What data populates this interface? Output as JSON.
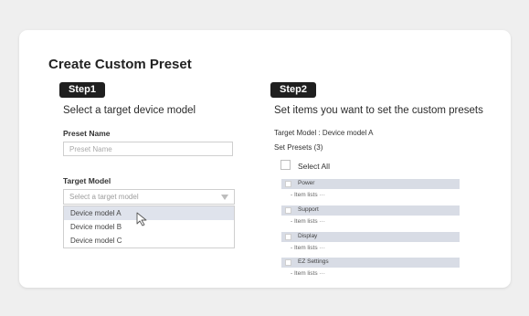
{
  "title": "Create Custom Preset",
  "step1": {
    "badge": "Step1",
    "heading": "Select a target device model",
    "preset_name_label": "Preset Name",
    "preset_name_placeholder": "Preset Name",
    "preset_name_value": "",
    "target_model_label": "Target Model",
    "target_model_placeholder": "Select a target model",
    "options": [
      "Device model A",
      "Device model B",
      "Device model C"
    ],
    "highlighted_option": "Device model A"
  },
  "step2": {
    "badge": "Step2",
    "heading": "Set items you want to set the custom presets",
    "target_model_text": "Target Model : Device model A",
    "set_presets_text": "Set Presets (3)",
    "select_all_label": "Select All",
    "categories": [
      {
        "label": "Power",
        "items": "- Item lists ···"
      },
      {
        "label": "Support",
        "items": "- Item lists ···"
      },
      {
        "label": "Display",
        "items": "- Item lists ···"
      },
      {
        "label": "EZ Settings",
        "items": "- Item lists ···"
      }
    ]
  },
  "colors": {
    "page_bg": "#efefef",
    "card_bg": "#ffffff",
    "badge_bg": "#1f1f1f",
    "category_bar": "#d8dce5",
    "highlight": "#dfe3ec"
  }
}
